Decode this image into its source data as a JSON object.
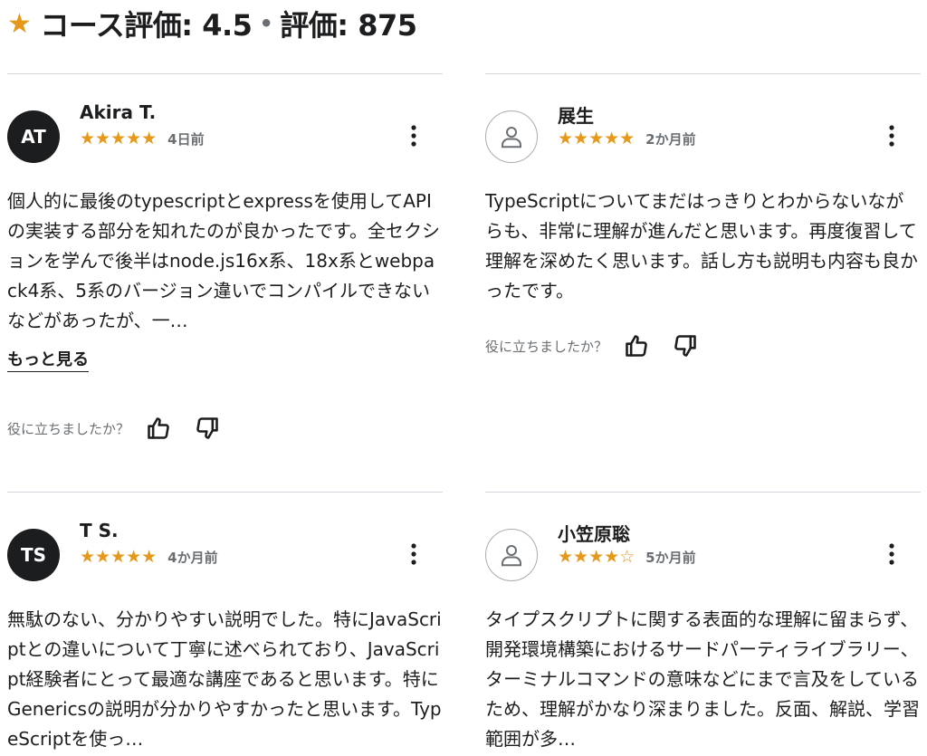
{
  "header": {
    "star": "★",
    "rating_label": "コース評価: 4.5",
    "separator": "•",
    "count_label": "評価: 875"
  },
  "reviews": [
    {
      "avatar_text": "AT",
      "avatar_type": "initials",
      "name": "Akira T.",
      "rating": 5,
      "stars": "★★★★★",
      "date": "4日前",
      "text": "個人的に最後のtypescriptとexpressを使用してAPIの実装する部分を知れたのが良かったです。全セクションを学んで後半はnode.js16x系、18x系とwebpack4系、5系のバージョン違いでコンパイルできないなどがあったが、一…",
      "more": "もっと見る",
      "helpful": "役に立ちましたか？"
    },
    {
      "avatar_type": "placeholder",
      "name": "展生",
      "rating": 5,
      "stars": "★★★★★",
      "date": "2か月前",
      "text": "TypeScriptについてまだはっきりとわからないながらも、非常に理解が進んだと思います。再度復習して理解を深めたく思います。話し方も説明も内容も良かったです。",
      "helpful": "役に立ちましたか？"
    },
    {
      "avatar_text": "TS",
      "avatar_type": "initials",
      "name": "T S.",
      "rating": 5,
      "stars": "★★★★★",
      "date": "4か月前",
      "text": "無駄のない、分かりやすい説明でした。特にJavaScriptとの違いについて丁寧に述べられており、JavaScript経験者にとって最適な講座であると思います。特にGenericsの説明が分かりやすかったと思います。TypeScriptを使っ…"
    },
    {
      "avatar_type": "placeholder",
      "name": "小笠原聡",
      "rating": 4,
      "stars": "★★★★☆",
      "date": "5か月前",
      "text": "タイプスクリプトに関する表面的な理解に留まらず、開発環境構築におけるサードパーティライブラリー、ターミナルコマンドの意味などにまで言及をしているため、理解がかなり深まりました。反面、解説、学習範囲が多…"
    }
  ],
  "colors": {
    "star": "#e59819",
    "text": "#1c1d1f",
    "muted": "#6a6f73",
    "divider": "#d1d7dc"
  },
  "icons": {
    "kebab": "more-vertical-icon",
    "thumbs_up": "thumbs-up-icon",
    "thumbs_down": "thumbs-down-icon",
    "user": "user-icon"
  }
}
